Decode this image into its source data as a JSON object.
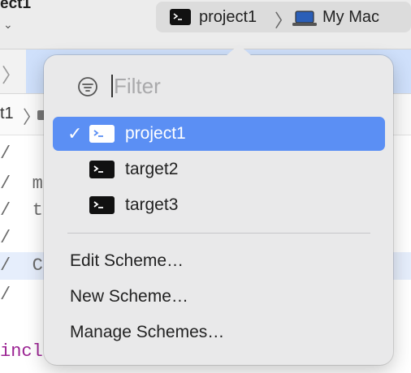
{
  "window": {
    "project_title": "ect1",
    "scheme": "project1",
    "destination": "My Mac"
  },
  "jumpbar": {
    "crumb": "t1"
  },
  "code": {
    "lines": [
      "/",
      "/  m",
      "/  t",
      "/",
      "/  C",
      "/",
      "incl"
    ]
  },
  "popover": {
    "filter_placeholder": "Filter",
    "schemes": [
      {
        "label": "project1",
        "selected": true
      },
      {
        "label": "target2",
        "selected": false
      },
      {
        "label": "target3",
        "selected": false
      }
    ],
    "actions": [
      "Edit Scheme…",
      "New Scheme…",
      "Manage Schemes…"
    ]
  },
  "colors": {
    "selection": "#5b8ff4",
    "popover_bg": "#e9e9ea"
  }
}
